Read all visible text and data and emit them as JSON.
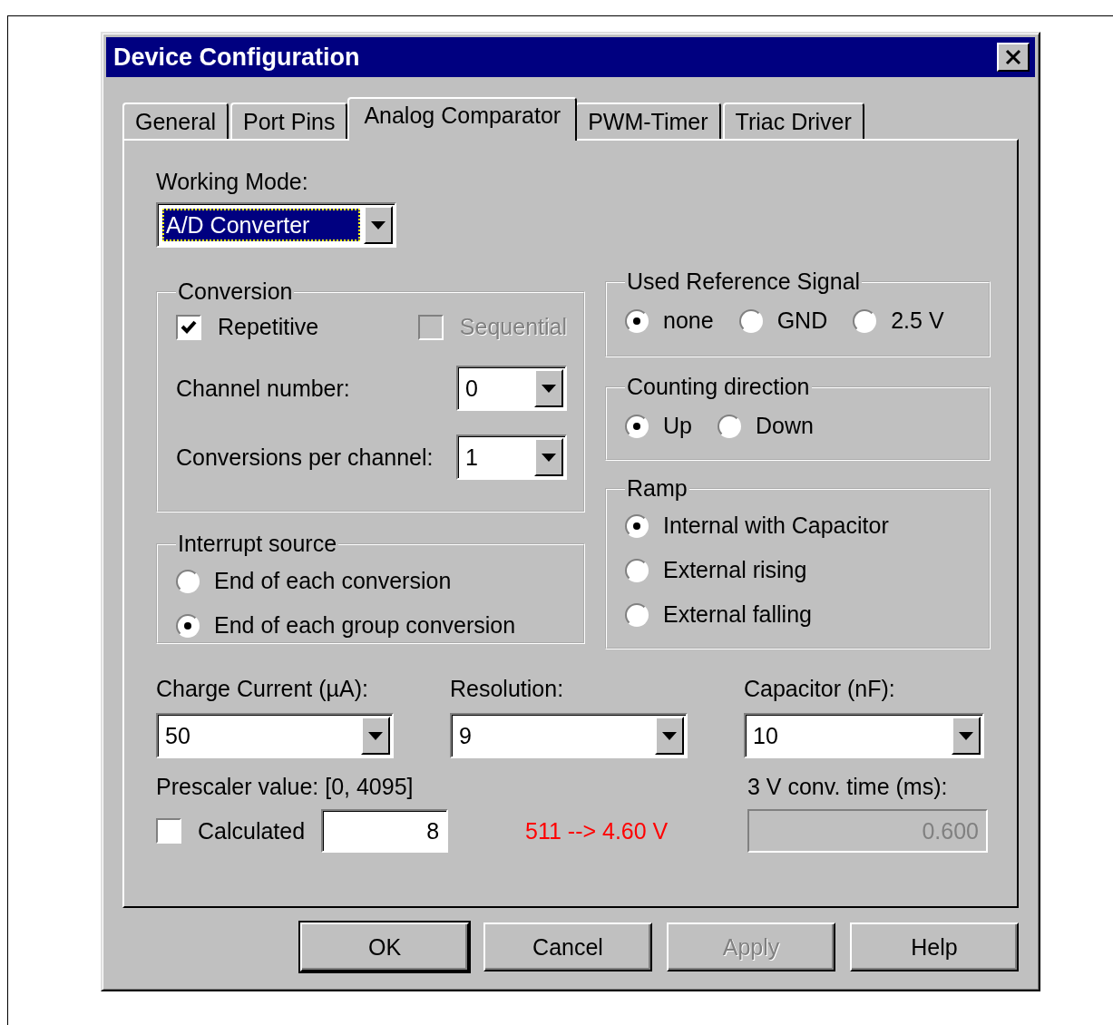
{
  "window": {
    "title": "Device Configuration"
  },
  "tabs": [
    {
      "label": "General",
      "selected": false
    },
    {
      "label": "Port Pins",
      "selected": false
    },
    {
      "label": "Analog Comparator",
      "selected": true
    },
    {
      "label": "PWM-Timer",
      "selected": false
    },
    {
      "label": "Triac Driver",
      "selected": false
    }
  ],
  "working_mode": {
    "label": "Working Mode:",
    "value": "A/D Converter",
    "focused": true
  },
  "conversion": {
    "title": "Conversion",
    "checkboxes": [
      {
        "label": "Repetitive",
        "checked": true,
        "disabled": false
      },
      {
        "label": "Sequential",
        "checked": false,
        "disabled": true
      }
    ],
    "fields": [
      {
        "label": "Channel number:",
        "value": "0"
      },
      {
        "label": "Conversions per channel:",
        "value": "1"
      }
    ]
  },
  "interrupt_source": {
    "title": "Interrupt source",
    "options": [
      {
        "label": "End of each conversion",
        "selected": false
      },
      {
        "label": "End of each group conversion",
        "selected": true
      }
    ]
  },
  "reference_signal": {
    "title": "Used Reference Signal",
    "options": [
      {
        "label": "none",
        "selected": true
      },
      {
        "label": "GND",
        "selected": false
      },
      {
        "label": "2.5 V",
        "selected": false
      }
    ]
  },
  "counting_direction": {
    "title": "Counting direction",
    "options": [
      {
        "label": "Up",
        "selected": true
      },
      {
        "label": "Down",
        "selected": false
      }
    ]
  },
  "ramp": {
    "title": "Ramp",
    "options": [
      {
        "label": "Internal with Capacitor",
        "selected": true
      },
      {
        "label": "External rising",
        "selected": false
      },
      {
        "label": "External falling",
        "selected": false
      }
    ]
  },
  "dropdowns": [
    {
      "label": "Charge Current (µA):",
      "value": "50"
    },
    {
      "label": "Resolution:",
      "value": "9"
    },
    {
      "label": "Capacitor (nF):",
      "value": "10"
    }
  ],
  "prescaler": {
    "label": "Prescaler value: [0, 4095]",
    "calculated": {
      "label": "Calculated",
      "checked": false
    },
    "value": "8"
  },
  "result": "511 --> 4.60 V",
  "conv_time": {
    "label": "3 V conv. time (ms):",
    "value": "0.600",
    "disabled": true
  },
  "buttons": [
    {
      "label": "OK",
      "default": true,
      "disabled": false
    },
    {
      "label": "Cancel",
      "default": false,
      "disabled": false
    },
    {
      "label": "Apply",
      "default": false,
      "disabled": true
    },
    {
      "label": "Help",
      "default": false,
      "disabled": false
    }
  ]
}
